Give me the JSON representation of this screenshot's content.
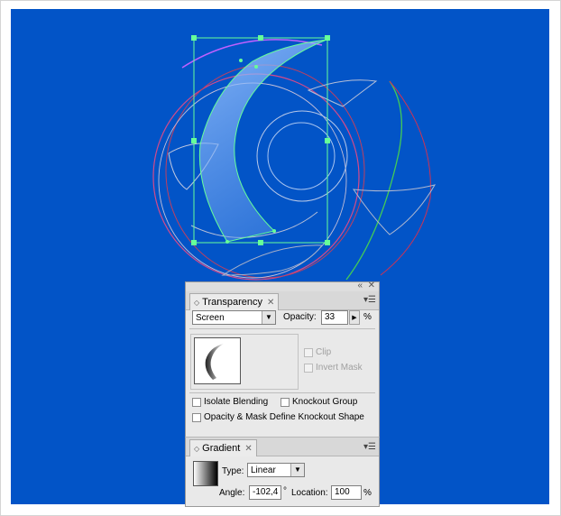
{
  "transparency": {
    "tab_label": "Transparency",
    "blend_mode": "Screen",
    "opacity_label": "Opacity:",
    "opacity_value": "33",
    "opacity_unit": "%",
    "clip_label": "Clip",
    "invert_mask_label": "Invert Mask",
    "isolate_blending_label": "Isolate Blending",
    "knockout_group_label": "Knockout Group",
    "opacity_mask_label": "Opacity & Mask Define Knockout Shape"
  },
  "gradient": {
    "tab_label": "Gradient",
    "type_label": "Type:",
    "type_value": "Linear",
    "angle_label": "Angle:",
    "angle_value": "-102,4",
    "angle_unit": "°",
    "location_label": "Location:",
    "location_value": "100",
    "location_unit": "%"
  },
  "colors": {
    "canvas": "#0254c7",
    "selection": "#66ff99"
  }
}
